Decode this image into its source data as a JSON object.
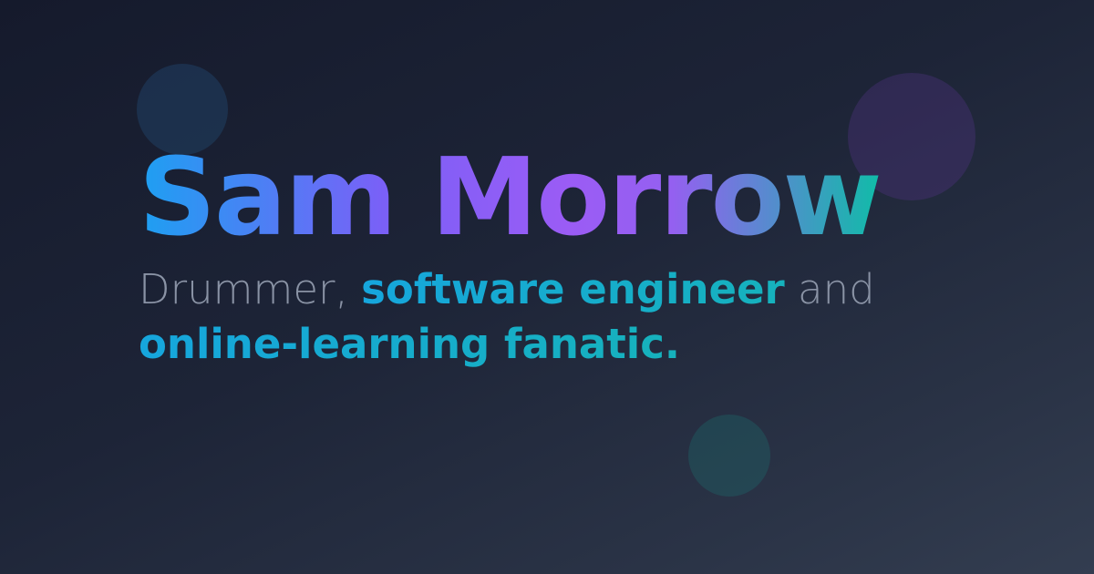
{
  "hero": {
    "name": "Sam Morrow",
    "tagline": {
      "prefix": "Drummer, ",
      "highlight_1": "software engineer",
      "connector": " and",
      "highlight_2": "online-learning fanatic."
    }
  },
  "colors": {
    "background_dark": "#151a2c",
    "background_light": "#333d50",
    "gradient_blue": "#1da0f2",
    "gradient_purple": "#9b5cf5",
    "gradient_teal": "#10bca8",
    "muted_text": "#8a93a5",
    "highlight_text": "#16a6dd"
  }
}
